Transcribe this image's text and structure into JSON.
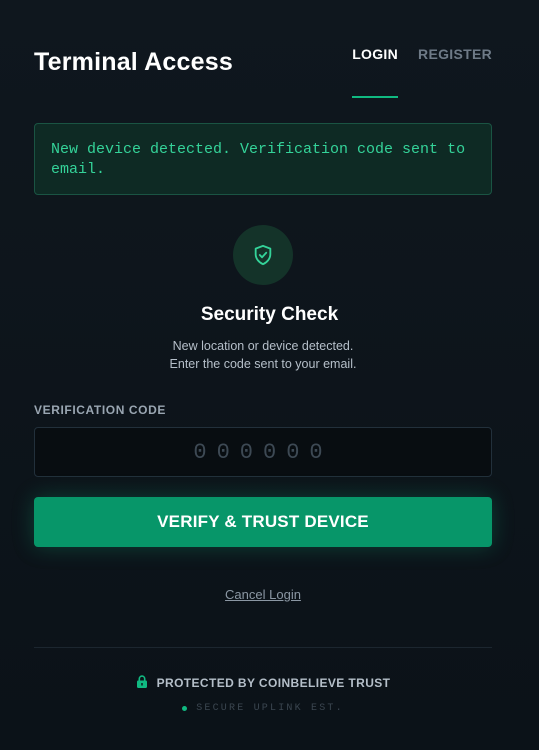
{
  "header": {
    "title": "Terminal Access",
    "tabs": [
      {
        "label": "LOGIN",
        "active": true
      },
      {
        "label": "REGISTER",
        "active": false
      }
    ]
  },
  "alert": {
    "message": "New device detected. Verification code sent to email."
  },
  "security": {
    "icon": "shield-check-icon",
    "title": "Security Check",
    "desc_line1": "New location or device detected.",
    "desc_line2": "Enter the code sent to your email."
  },
  "form": {
    "code_label": "VERIFICATION CODE",
    "code_placeholder": "000000",
    "code_value": "",
    "verify_label": "VERIFY & TRUST DEVICE",
    "cancel_label": "Cancel Login"
  },
  "footer": {
    "lock_icon": "lock-icon",
    "protected_text": "PROTECTED BY COINBELIEVE TRUST",
    "uplink_text": "SECURE UPLINK EST."
  },
  "colors": {
    "accent": "#10b981",
    "button": "#079669",
    "background": "#0d141b",
    "alert_text": "#34d399"
  }
}
